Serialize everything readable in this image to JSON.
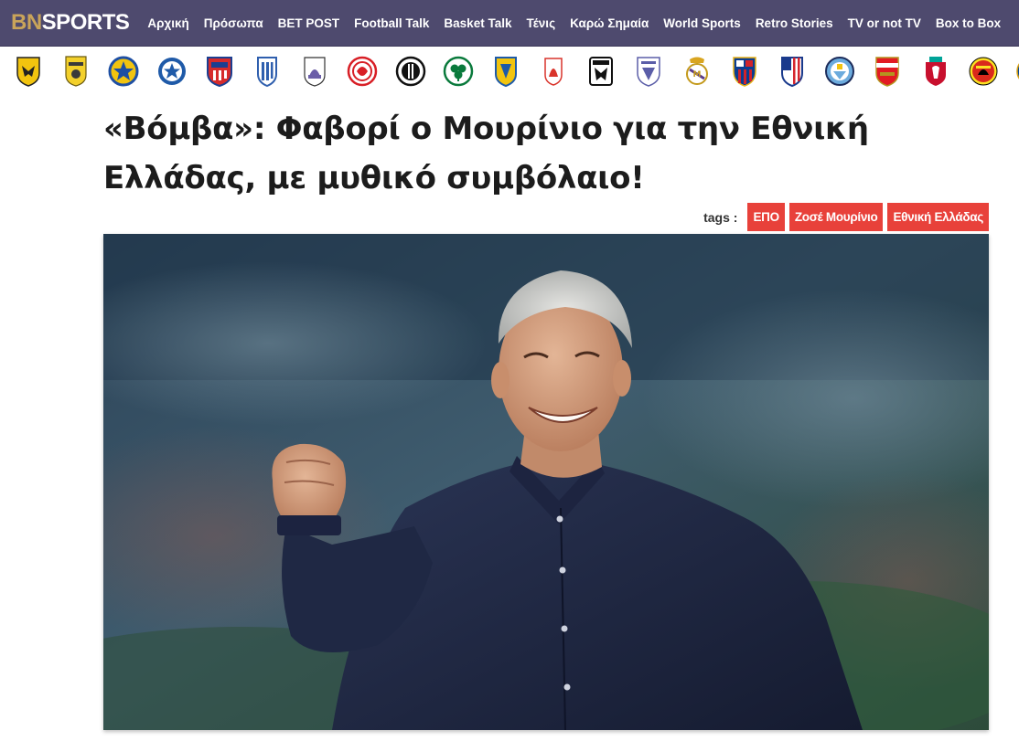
{
  "site": {
    "logo_part1": "BN",
    "logo_part2": "SPORTS",
    "brand_gold": "#c9a45a",
    "nav_bg": "#4e4a6e"
  },
  "nav": {
    "items": [
      {
        "label": "Αρχική"
      },
      {
        "label": "Πρόσωπα"
      },
      {
        "label": "BET POST"
      },
      {
        "label": "Football Talk"
      },
      {
        "label": "Basket Talk"
      },
      {
        "label": "Τένις"
      },
      {
        "label": "Καρώ Σημαία"
      },
      {
        "label": "World Sports"
      },
      {
        "label": "Retro Stories"
      },
      {
        "label": "TV or not TV"
      },
      {
        "label": "Box to Box"
      }
    ]
  },
  "crests": [
    {
      "icon": "aek-crest-icon"
    },
    {
      "icon": "aris-crest-icon"
    },
    {
      "icon": "asteras-tripolis-crest-icon"
    },
    {
      "icon": "atromitos-crest-icon"
    },
    {
      "icon": "volos-crest-icon"
    },
    {
      "icon": "kifisia-crest-icon"
    },
    {
      "icon": "lamia-crest-icon"
    },
    {
      "icon": "olympiacos-crest-icon"
    },
    {
      "icon": "ofi-crest-icon"
    },
    {
      "icon": "panathinaikos-crest-icon"
    },
    {
      "icon": "panetolikos-crest-icon"
    },
    {
      "icon": "panserraikos-crest-icon"
    },
    {
      "icon": "paok-crest-icon"
    },
    {
      "icon": "levadiakos-crest-icon"
    },
    {
      "icon": "real-madrid-crest-icon"
    },
    {
      "icon": "barcelona-crest-icon"
    },
    {
      "icon": "atletico-madrid-crest-icon"
    },
    {
      "icon": "manchester-city-crest-icon"
    },
    {
      "icon": "arsenal-crest-icon"
    },
    {
      "icon": "liverpool-crest-icon"
    },
    {
      "icon": "manchester-united-crest-icon"
    },
    {
      "icon": "chelsea-crest-icon"
    }
  ],
  "article": {
    "title": "«Βόμβα»: Φαβορί ο Μουρίνιο για την Εθνική Ελλάδας, με μυθικό συμβόλαιο!",
    "tags_label": "tags :",
    "tags": [
      {
        "label": "ΕΠΟ"
      },
      {
        "label": "Ζοσέ Μουρίνιο"
      },
      {
        "label": "Εθνική Ελλάδας"
      }
    ],
    "tag_color": "#e8413a",
    "hero_icon": "coach-celebrating-photo"
  }
}
